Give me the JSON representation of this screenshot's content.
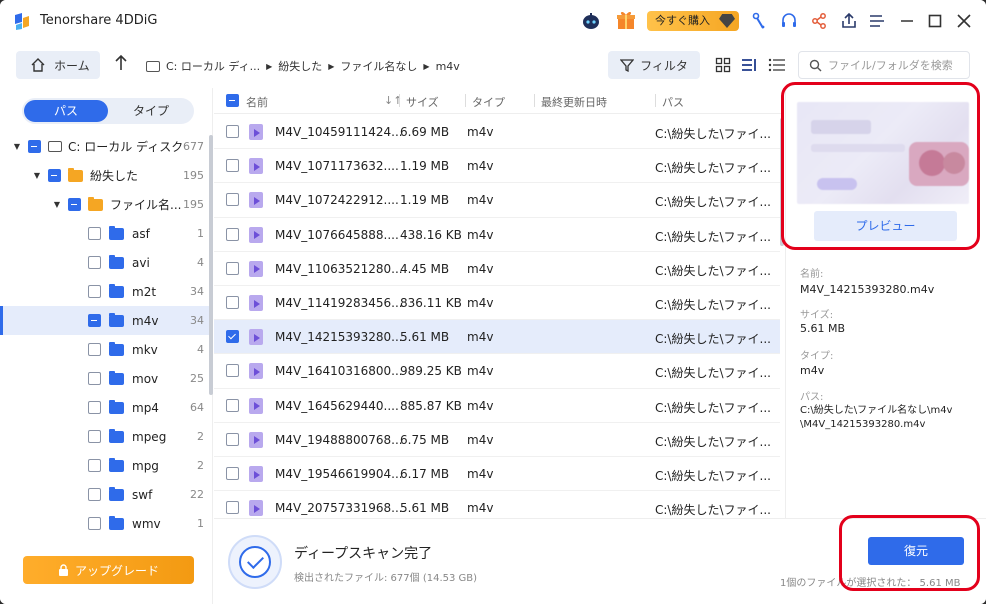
{
  "app": {
    "title": "Tenorshare 4DDiG",
    "buy_label": "今すぐ購入"
  },
  "colors": {
    "accent": "#2f6bea",
    "upgrade": "#f5a623",
    "highlight": "#e3001b"
  },
  "toolbar": {
    "home_label": "ホーム",
    "breadcrumb": [
      "C: ローカル ディ...",
      "紛失した",
      "ファイル名なし",
      "m4v"
    ],
    "filter_label": "フィルタ",
    "search_placeholder": "ファイル/フォルダを検索"
  },
  "sidebar": {
    "tabs": [
      "パス",
      "タイプ"
    ],
    "tree": [
      {
        "label": "C: ローカル ディスク",
        "count": "677"
      },
      {
        "label": "紛失した",
        "count": "195"
      },
      {
        "label": "ファイル名...",
        "count": "195"
      },
      {
        "label": "asf",
        "count": "1"
      },
      {
        "label": "avi",
        "count": "4"
      },
      {
        "label": "m2t",
        "count": "34"
      },
      {
        "label": "m4v",
        "count": "34"
      },
      {
        "label": "mkv",
        "count": "4"
      },
      {
        "label": "mov",
        "count": "25"
      },
      {
        "label": "mp4",
        "count": "64"
      },
      {
        "label": "mpeg",
        "count": "2"
      },
      {
        "label": "mpg",
        "count": "2"
      },
      {
        "label": "swf",
        "count": "22"
      },
      {
        "label": "wmv",
        "count": "1"
      }
    ],
    "upgrade_label": "アップグレード"
  },
  "table": {
    "headers": {
      "name": "名前",
      "size": "サイズ",
      "type": "タイプ",
      "modified": "最終更新日時",
      "path": "パス"
    },
    "rows": [
      {
        "name": "M4V_10459111424...",
        "size": "6.69 MB",
        "type": "m4v",
        "path": "C:\\紛失した\\ファイ..."
      },
      {
        "name": "M4V_1071173632....",
        "size": "1.19 MB",
        "type": "m4v",
        "path": "C:\\紛失した\\ファイ..."
      },
      {
        "name": "M4V_1072422912....",
        "size": "1.19 MB",
        "type": "m4v",
        "path": "C:\\紛失した\\ファイ..."
      },
      {
        "name": "M4V_1076645888....",
        "size": "438.16 KB",
        "type": "m4v",
        "path": "C:\\紛失した\\ファイ..."
      },
      {
        "name": "M4V_11063521280...",
        "size": "4.45 MB",
        "type": "m4v",
        "path": "C:\\紛失した\\ファイ..."
      },
      {
        "name": "M4V_11419283456...",
        "size": "836.11 KB",
        "type": "m4v",
        "path": "C:\\紛失した\\ファイ..."
      },
      {
        "name": "M4V_14215393280...",
        "size": "5.61 MB",
        "type": "m4v",
        "path": "C:\\紛失した\\ファイ..."
      },
      {
        "name": "M4V_16410316800...",
        "size": "989.25 KB",
        "type": "m4v",
        "path": "C:\\紛失した\\ファイ..."
      },
      {
        "name": "M4V_1645629440....",
        "size": "885.87 KB",
        "type": "m4v",
        "path": "C:\\紛失した\\ファイ..."
      },
      {
        "name": "M4V_19488800768...",
        "size": "6.75 MB",
        "type": "m4v",
        "path": "C:\\紛失した\\ファイ..."
      },
      {
        "name": "M4V_19546619904...",
        "size": "6.17 MB",
        "type": "m4v",
        "path": "C:\\紛失した\\ファイ..."
      },
      {
        "name": "M4V_20757331968...",
        "size": "5.61 MB",
        "type": "m4v",
        "path": "C:\\紛失した\\ファイ..."
      }
    ]
  },
  "details": {
    "preview_label": "プレビュー",
    "name_label": "名前:",
    "name_value": "M4V_14215393280.m4v",
    "size_label": "サイズ:",
    "size_value": "5.61 MB",
    "type_label": "タイプ:",
    "type_value": "m4v",
    "path_label": "パス:",
    "path_line1": "C:\\紛失した\\ファイル名なし\\m4v",
    "path_line2": "\\M4V_14215393280.m4v"
  },
  "status": {
    "title": "ディープスキャン完了",
    "found": "検出されたファイル: 677個 (14.53 GB)",
    "recover_label": "復元",
    "selected_info": "1個のファイルが選択された：  5.61 MB"
  }
}
